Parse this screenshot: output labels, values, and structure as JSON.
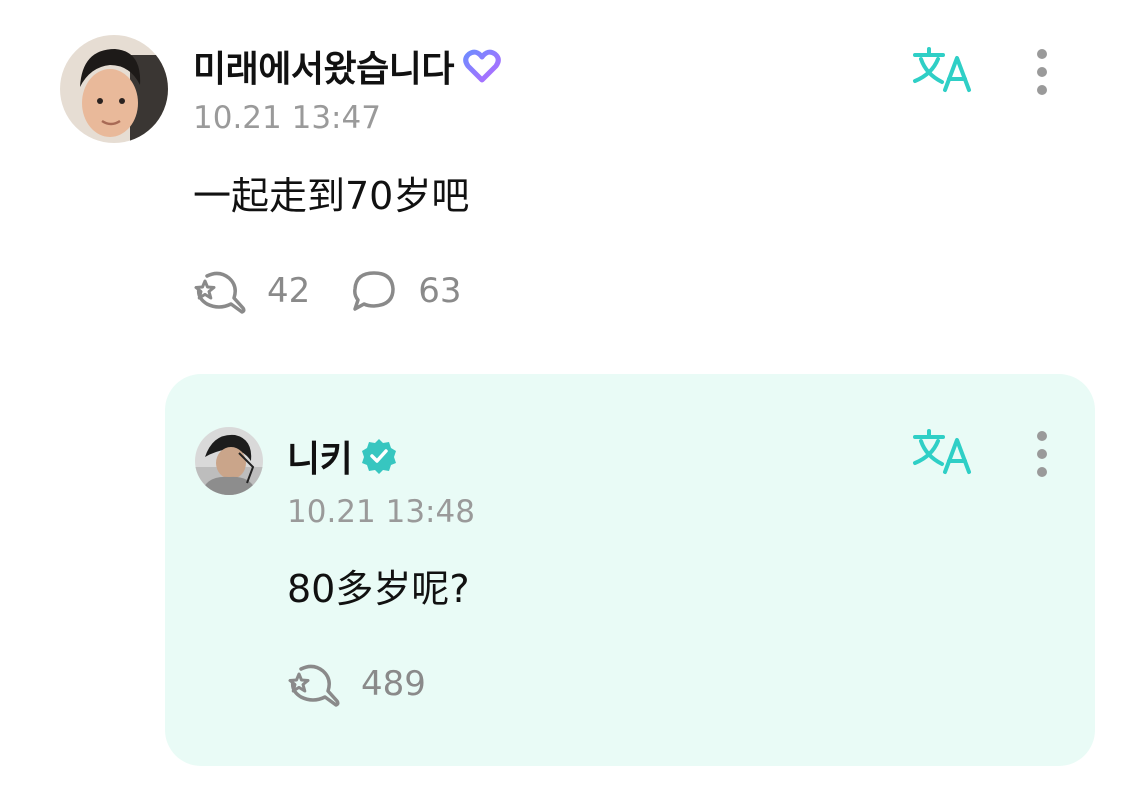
{
  "post": {
    "author": "미래에서왔습니다",
    "time": "10.21 13:47",
    "text": "一起走到70岁吧",
    "like_count": "42",
    "comment_count": "63",
    "badge_icon": "heart-badge-icon"
  },
  "reply": {
    "author": "니키",
    "time": "10.21 13:48",
    "text": "80多岁呢?",
    "like_count": "489",
    "badge_icon": "verified-badge-icon"
  },
  "colors": {
    "accent": "#2fcfc6",
    "reply_bg": "#e9fbf6",
    "muted": "#9a9a9a"
  }
}
